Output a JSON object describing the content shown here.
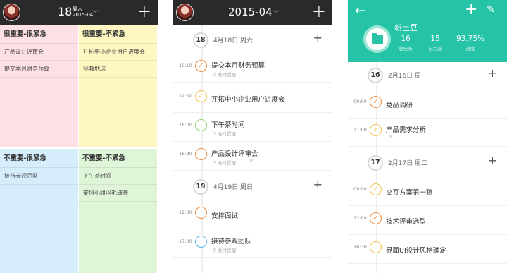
{
  "screen1": {
    "date": "18",
    "weekday": "周六",
    "month": "2015-04",
    "quadrants": [
      {
        "title": "很重要-很紧急",
        "items": [
          "产品设计评审会",
          "提交本月财务预算"
        ]
      },
      {
        "title": "很重要-不紧急",
        "items": [
          "开拓中小企业用户进度会",
          "拯救地球"
        ]
      },
      {
        "title": "不重要-很紧急",
        "items": [
          "接待参观团队"
        ]
      },
      {
        "title": "不重要-不紧急",
        "items": [
          "下午茶时间",
          "安排小组羽毛球赛"
        ]
      }
    ]
  },
  "screen2": {
    "title": "2015-04",
    "days": [
      {
        "num": "18",
        "label": "4月18日 周六",
        "tasks": [
          {
            "time": "10:10",
            "title": "提交本月财务预算",
            "reminder": "准时提醒",
            "color": "#f08a3c",
            "done": true
          },
          {
            "time": "12:00",
            "title": "开拓中小企业用户进度会",
            "reminder": "",
            "color": "#f5c04a",
            "done": true
          },
          {
            "time": "16:00",
            "title": "下午茶时间",
            "reminder": "准时提醒",
            "color": "#8fd16a",
            "done": false
          },
          {
            "time": "16:30",
            "title": "产品设计评审会",
            "reminder": "准时提醒",
            "color": "#f08a3c",
            "done": false
          }
        ]
      },
      {
        "num": "19",
        "label": "4月19日 周日",
        "tasks": [
          {
            "time": "12:00",
            "title": "安排面试",
            "reminder": "",
            "color": "#f08a3c",
            "done": false
          },
          {
            "time": "17:00",
            "title": "接待参观团队",
            "reminder": "准时提醒",
            "color": "#4fb6e8",
            "done": false
          }
        ]
      }
    ]
  },
  "screen3": {
    "project": "新土豆",
    "stats": [
      {
        "value": "16",
        "label": "总任务"
      },
      {
        "value": "15",
        "label": "已完成"
      },
      {
        "value": "93.75%",
        "label": "进度"
      }
    ],
    "days": [
      {
        "num": "16",
        "label": "2月16日 周一",
        "tasks": [
          {
            "time": "09:00",
            "title": "竞品调研",
            "color": "#f08a3c",
            "done": true
          },
          {
            "time": "11:00",
            "title": "产品需求分析",
            "color": "#f5c04a",
            "done": true
          }
        ]
      },
      {
        "num": "17",
        "label": "2月17日 周二",
        "tasks": [
          {
            "time": "09:00",
            "title": "交互方案第一稿",
            "color": "#f5c04a",
            "done": true
          },
          {
            "time": "12:00",
            "title": "技术评审选型",
            "color": "#f08a3c",
            "done": true
          },
          {
            "time": "16:30",
            "title": "界面UI设计风格确定",
            "color": "#f5c04a",
            "done": false
          }
        ]
      }
    ]
  }
}
